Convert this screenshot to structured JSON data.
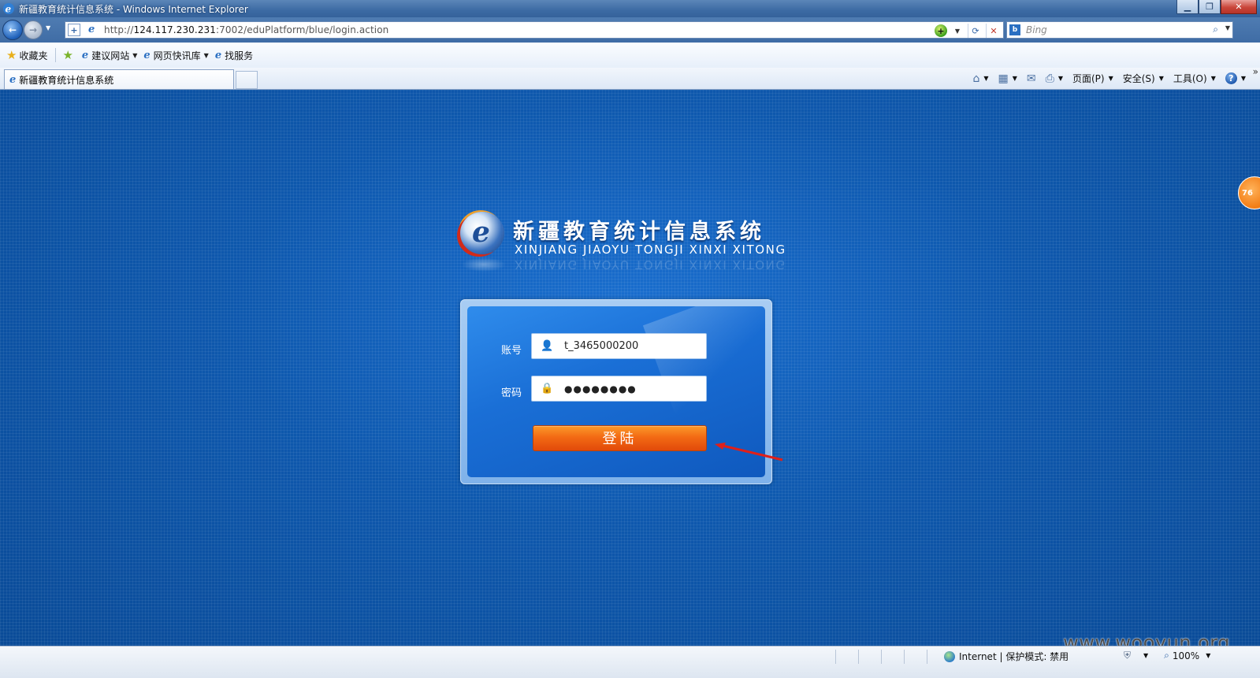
{
  "window": {
    "title": "新疆教育统计信息系统 - Windows Internet Explorer"
  },
  "address": {
    "url_prefix": "http://",
    "url_host": "124.117.230.231",
    "url_rest": ":7002/eduPlatform/blue/login.action"
  },
  "search": {
    "placeholder": "Bing"
  },
  "favorites": {
    "label": "收藏夹",
    "items": [
      {
        "label": "建议网站"
      },
      {
        "label": "网页快讯库"
      },
      {
        "label": "找服务"
      }
    ]
  },
  "tabs": [
    {
      "label": "新疆教育统计信息系统"
    }
  ],
  "commands": {
    "page": "页面(P)",
    "safety": "安全(S)",
    "tools": "工具(O)"
  },
  "logo": {
    "title_cn": "新疆教育统计信息系统",
    "title_en": "XINJIANG JIAOYU TONGJI XINXI XITONG"
  },
  "login": {
    "account_label": "账号",
    "account_value": "t_3465000200",
    "password_label": "密码",
    "password_value": "●●●●●●●●",
    "submit_label": "登陆"
  },
  "side_badge": "76",
  "watermark": "www.wooyun.org",
  "status": {
    "zone": "Internet | 保护模式: 禁用",
    "zoom": "100%"
  },
  "colors": {
    "page_bg": "#0f56a8",
    "login_button": "#f36a14",
    "arrow": "#e0201a"
  }
}
